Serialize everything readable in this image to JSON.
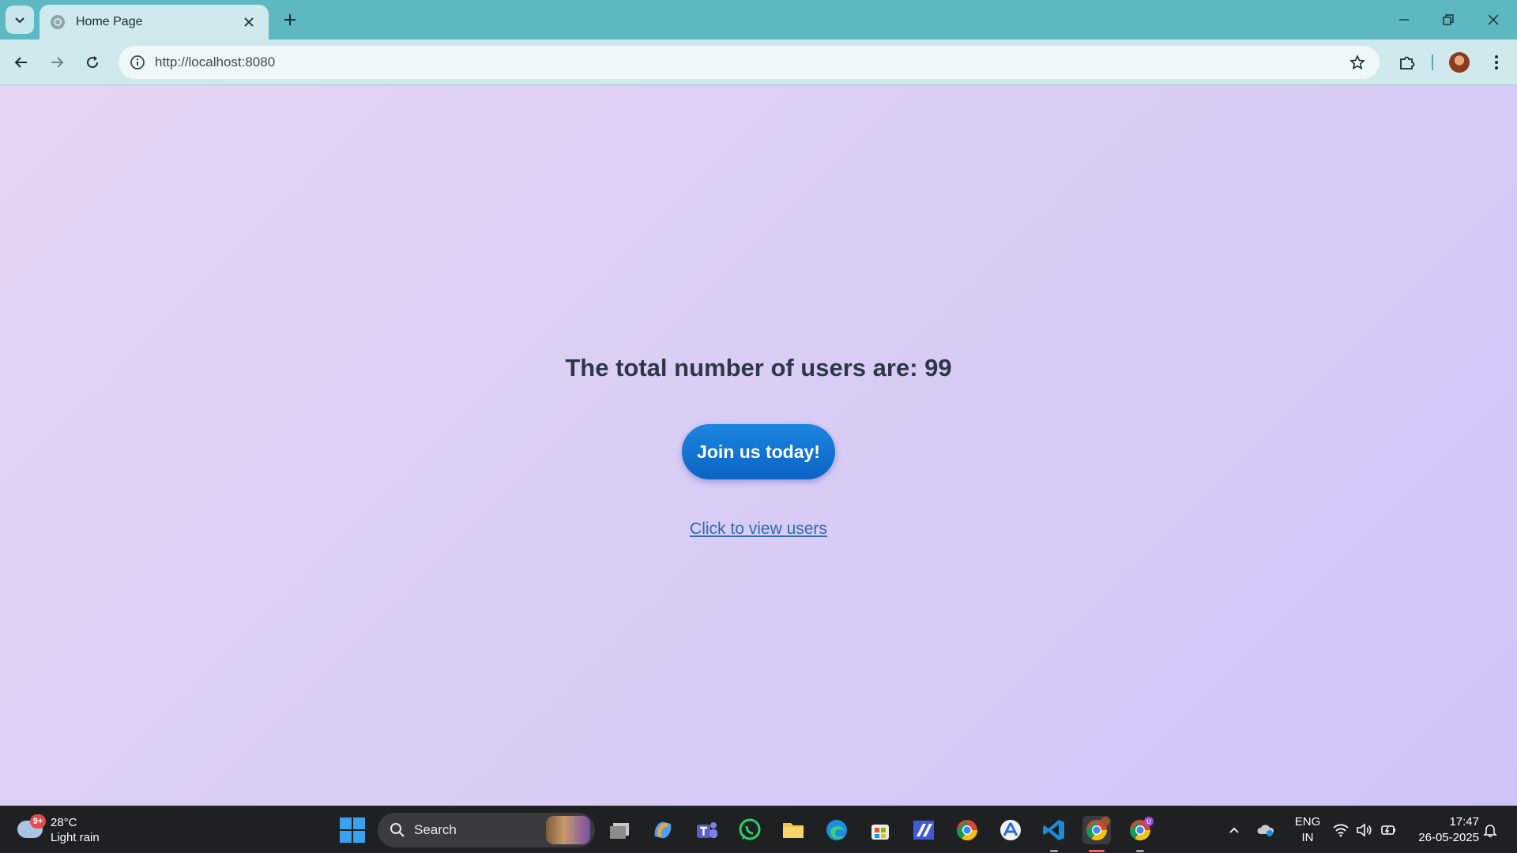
{
  "browser": {
    "tab_title": "Home Page",
    "url": "http://localhost:8080"
  },
  "page": {
    "headline": "The total number of users are: 99",
    "join_button_label": "Join us today!",
    "view_users_link": "Click to view users"
  },
  "taskbar": {
    "weather": {
      "badge": "9+",
      "temperature": "28°C",
      "condition": "Light rain"
    },
    "search_placeholder": "Search",
    "apps": [
      "task-view",
      "copilot",
      "teams",
      "whatsapp",
      "file-explorer",
      "edge",
      "microsoft-store",
      "app-monitor",
      "chrome",
      "app-store",
      "vscode",
      "chrome-active",
      "chrome-profile"
    ],
    "tray": {
      "language_line1": "ENG",
      "language_line2": "IN",
      "time": "17:47",
      "date": "26-05-2025"
    }
  },
  "colors": {
    "tab_bar": "#5eb8c2",
    "toolbar": "#cfe9ed",
    "button_blue": "#0b63c4",
    "headline_text": "#2d3748",
    "link": "#2b6cb0",
    "taskbar": "#1f2022"
  }
}
